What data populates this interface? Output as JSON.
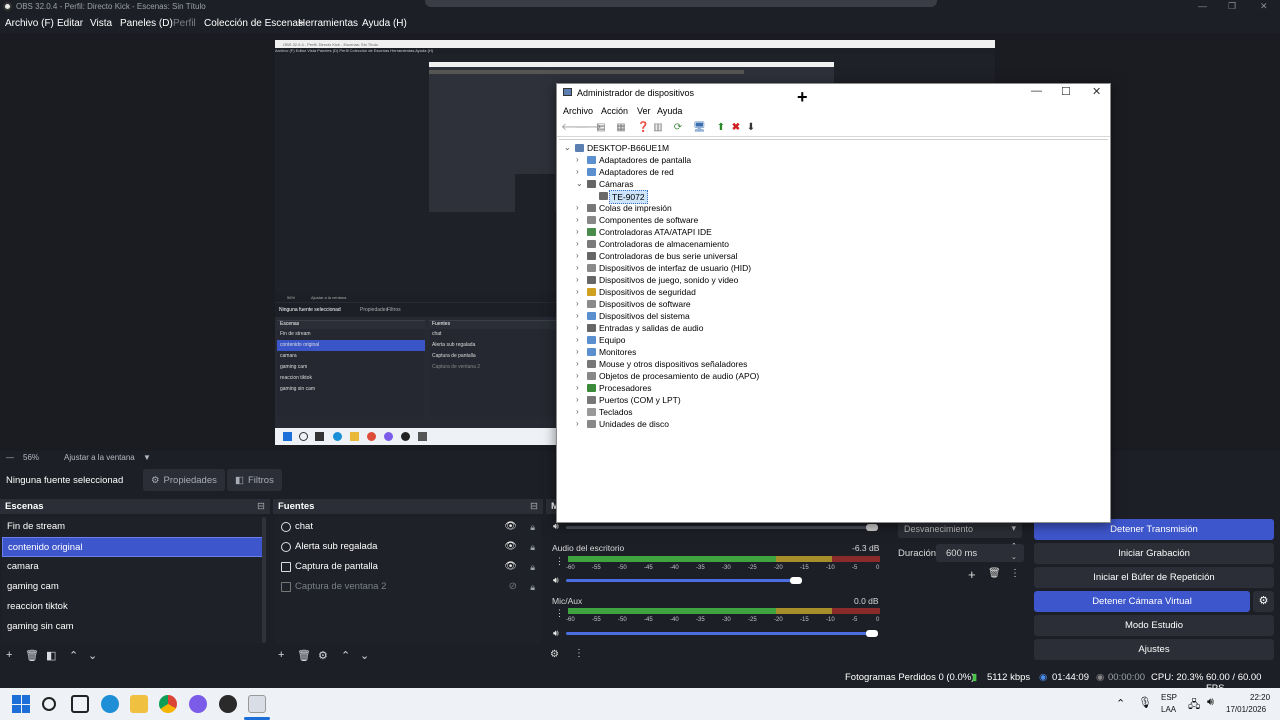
{
  "obs": {
    "title": "OBS 32.0.4 - Perfil: Directo Kick - Escenas: Sin Título",
    "menu": [
      "Archivo (F)",
      "Editar",
      "Vista",
      "Paneles (D)",
      "Perfil",
      "Colección de Escenas",
      "Herramientas",
      "Ayuda (H)"
    ],
    "zoom": "56%",
    "fit": "Ajustar a la ventana",
    "no_source": "Ninguna fuente seleccionad",
    "properties": "Propiedades",
    "filters": "Filtros",
    "scenes_title": "Escenas",
    "scenes": [
      "Fin de stream",
      "contenido original",
      "camara",
      "gaming cam",
      "reaccion tiktok",
      "gaming sin cam"
    ],
    "sources_title": "Fuentes",
    "sources": [
      {
        "label": "chat",
        "icon": "browser-icon",
        "visible": true
      },
      {
        "label": "Alerta sub regalada",
        "icon": "browser-icon",
        "visible": true
      },
      {
        "label": "Captura de pantalla",
        "icon": "monitor-icon",
        "visible": true
      },
      {
        "label": "Captura de ventana 2",
        "icon": "window-icon",
        "visible": false
      }
    ],
    "mixer_title": "M",
    "mixer": [
      {
        "name": "Audio del escritorio",
        "db": "-6.3 dB"
      },
      {
        "name": "Mic/Aux",
        "db": "0.0 dB"
      }
    ],
    "ticks": [
      "-60",
      "-55",
      "-50",
      "-45",
      "-40",
      "-35",
      "-30",
      "-25",
      "-20",
      "-15",
      "-10",
      "-5",
      "0"
    ],
    "transition": "Desvanecimiento",
    "duration_label": "Duración",
    "duration_value": "600 ms",
    "controls": {
      "stop_stream": "Detener Transmisión",
      "start_record": "Iniciar Grabación",
      "replay": "Iniciar el Búfer de Repetición",
      "stop_vcam": "Detener Cámara Virtual",
      "studio": "Modo Estudio",
      "settings": "Ajustes"
    },
    "status": {
      "dropped": "Fotogramas Perdidos 0 (0.0%)",
      "kbps": "5112 kbps",
      "live_time": "01:44:09",
      "rec_time": "00:00:00",
      "cpu": "CPU: 20.3%",
      "fps": "60.00 / 60.00 FPS"
    },
    "colors": {
      "accent": "#3e56cc",
      "bg": "#1d1f26",
      "panel": "#2b2e36"
    }
  },
  "taskbar": {
    "lang": "ESP",
    "lang2": "LAA",
    "time": "22:20",
    "date": "17/01/2026"
  },
  "device_manager": {
    "title": "Administrador de dispositivos",
    "menu": [
      "Archivo",
      "Acción",
      "Ver",
      "Ayuda"
    ],
    "root": "DESKTOP-B66UE1M",
    "nodes": [
      {
        "label": "Adaptadores de pantalla",
        "icon": "display-adapter-icon",
        "expanded": false
      },
      {
        "label": "Adaptadores de red",
        "icon": "network-icon",
        "expanded": false
      },
      {
        "label": "Cámaras",
        "icon": "camera-icon",
        "expanded": true
      },
      {
        "label": "Colas de impresión",
        "icon": "printer-icon",
        "expanded": false
      },
      {
        "label": "Componentes de software",
        "icon": "software-component-icon",
        "expanded": false
      },
      {
        "label": "Controladoras ATA/ATAPI IDE",
        "icon": "ide-icon",
        "expanded": false
      },
      {
        "label": "Controladoras de almacenamiento",
        "icon": "storage-icon",
        "expanded": false
      },
      {
        "label": "Controladoras de bus serie universal",
        "icon": "usb-icon",
        "expanded": false
      },
      {
        "label": "Dispositivos de interfaz de usuario (HID)",
        "icon": "hid-icon",
        "expanded": false
      },
      {
        "label": "Dispositivos de juego, sonido y video",
        "icon": "sound-icon",
        "expanded": false
      },
      {
        "label": "Dispositivos de seguridad",
        "icon": "security-icon",
        "expanded": false
      },
      {
        "label": "Dispositivos de software",
        "icon": "software-device-icon",
        "expanded": false
      },
      {
        "label": "Dispositivos del sistema",
        "icon": "system-icon",
        "expanded": false
      },
      {
        "label": "Entradas y salidas de audio",
        "icon": "audio-io-icon",
        "expanded": false
      },
      {
        "label": "Equipo",
        "icon": "computer-icon",
        "expanded": false
      },
      {
        "label": "Monitores",
        "icon": "monitor-icon",
        "expanded": false
      },
      {
        "label": "Mouse y otros dispositivos señaladores",
        "icon": "mouse-icon",
        "expanded": false
      },
      {
        "label": "Objetos de procesamiento de audio (APO)",
        "icon": "apo-icon",
        "expanded": false
      },
      {
        "label": "Procesadores",
        "icon": "cpu-icon",
        "expanded": false
      },
      {
        "label": "Puertos (COM y LPT)",
        "icon": "port-icon",
        "expanded": false
      },
      {
        "label": "Teclados",
        "icon": "keyboard-icon",
        "expanded": false
      },
      {
        "label": "Unidades de disco",
        "icon": "disk-icon",
        "expanded": false
      }
    ],
    "camera_child": "TE-9072"
  },
  "nested_preview": {
    "title": "OBS 32.0.4 - Perfil: Directo Kick - Escenas: Sin Título",
    "menu": "Archivo (F)   Editar   Vista   Paneles (D)   Perfil   Colección de Escenas   Herramientas   Ayuda (H)",
    "zoom": "56%",
    "fit": "Ajustar a la ventana",
    "no_source": "Ninguna fuente seleccionad",
    "properties": "Propiedades",
    "filters": "Filtros",
    "scenes_title": "Escenas",
    "sources_title": "Fuentes",
    "scenes": [
      "Fin de stream",
      "contenido original",
      "camara",
      "gaming cam",
      "reaccion tiktok",
      "gaming sin cam"
    ],
    "sources": [
      "chat",
      "Alerta sub regalada",
      "Captura de pantalla",
      "Captura de ventana 2"
    ]
  }
}
